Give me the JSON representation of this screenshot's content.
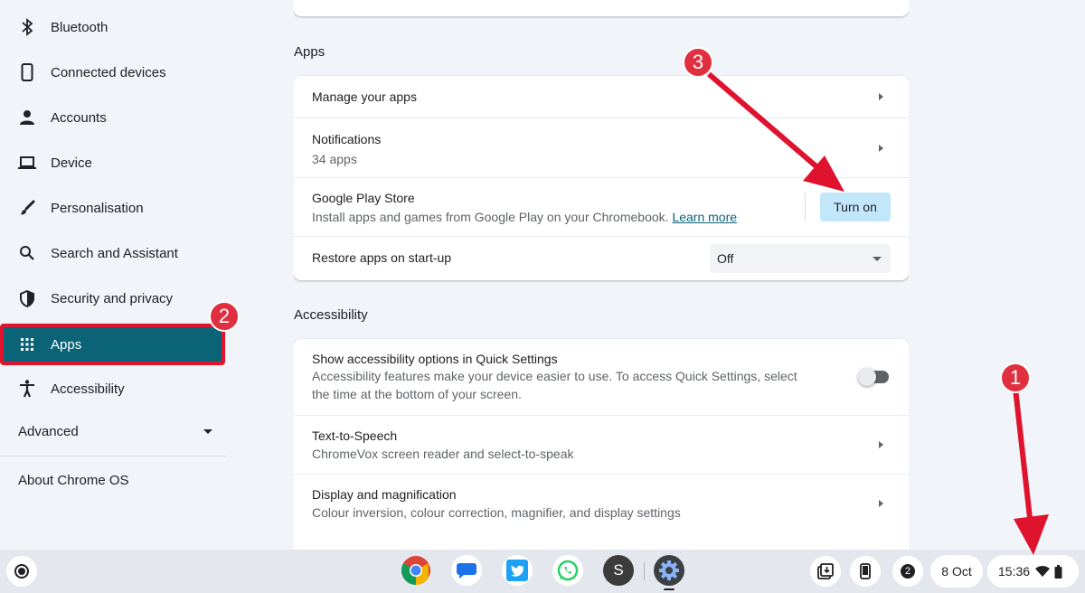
{
  "sidebar": {
    "items": [
      {
        "label": "Bluetooth",
        "icon": "bluetooth-icon"
      },
      {
        "label": "Connected devices",
        "icon": "phone-icon"
      },
      {
        "label": "Accounts",
        "icon": "person-icon"
      },
      {
        "label": "Device",
        "icon": "laptop-icon"
      },
      {
        "label": "Personalisation",
        "icon": "brush-icon"
      },
      {
        "label": "Search and Assistant",
        "icon": "search-icon"
      },
      {
        "label": "Security and privacy",
        "icon": "shield-icon"
      },
      {
        "label": "Apps",
        "icon": "apps-grid-icon",
        "active": true
      },
      {
        "label": "Accessibility",
        "icon": "accessibility-icon"
      }
    ],
    "advanced_label": "Advanced",
    "about_label": "About Chrome OS"
  },
  "apps_section": {
    "title": "Apps",
    "rows": {
      "manage": {
        "title": "Manage your apps"
      },
      "notifications": {
        "title": "Notifications",
        "subtitle": "34 apps"
      },
      "play_store": {
        "title": "Google Play Store",
        "subtitle": "Install apps and games from Google Play on your Chromebook.",
        "link": "Learn more",
        "button": "Turn on"
      },
      "restore": {
        "title": "Restore apps on start-up",
        "value": "Off"
      }
    }
  },
  "accessibility_section": {
    "title": "Accessibility",
    "rows": {
      "quick_settings": {
        "title": "Show accessibility options in Quick Settings",
        "subtitle": "Accessibility features make your device easier to use. To access Quick Settings, select the time at the bottom of your screen.",
        "toggle": "off"
      },
      "tts": {
        "title": "Text-to-Speech",
        "subtitle": "ChromeVox screen reader and select-to-speak"
      },
      "display": {
        "title": "Display and magnification",
        "subtitle": "Colour inversion, colour correction, magnifier, and display settings"
      }
    }
  },
  "shelf": {
    "apps": [
      "chrome-icon",
      "messages-icon",
      "twitter-icon",
      "whatsapp-icon",
      "avatar-s-icon",
      "settings-icon"
    ],
    "avatar_letter": "S",
    "notification_count": "2",
    "date": "8 Oct",
    "time": "15:36"
  },
  "annotations": {
    "badge_1": "1",
    "badge_2": "2",
    "badge_3": "3"
  },
  "colors": {
    "active_nav": "#0b6378",
    "annotation_red": "#e0132f",
    "turn_on_button": "#c2e7fb"
  }
}
